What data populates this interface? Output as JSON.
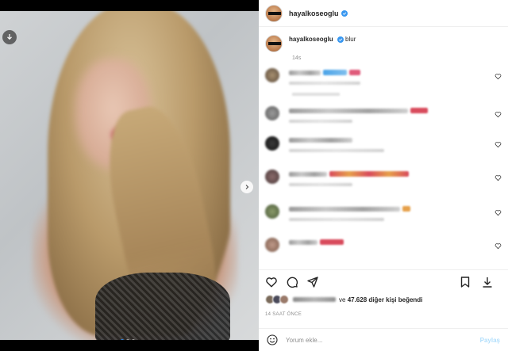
{
  "post": {
    "username": "hayalkoseoglu",
    "caption_username": "hayalkoseoglu",
    "caption_text": "blur",
    "caption_time": "14s"
  },
  "icons": {
    "download": "download-icon",
    "next": "chevron-right-icon",
    "heart": "heart-icon",
    "comment": "comment-icon",
    "share": "share-icon",
    "save": "bookmark-icon",
    "verified": "verified-badge-icon",
    "emoji": "emoji-icon"
  },
  "likes": {
    "connector": "ve",
    "count": "47.628",
    "suffix": "diğer kişi beğendi"
  },
  "timeago": "14 SAAT ÖNCE",
  "add_comment": {
    "placeholder": "Yorum ekle...",
    "post_label": "Paylaş"
  },
  "colors": {
    "accent": "#3897f0",
    "post_button": "#b2dffc",
    "muted_text": "#8e8e8e"
  }
}
